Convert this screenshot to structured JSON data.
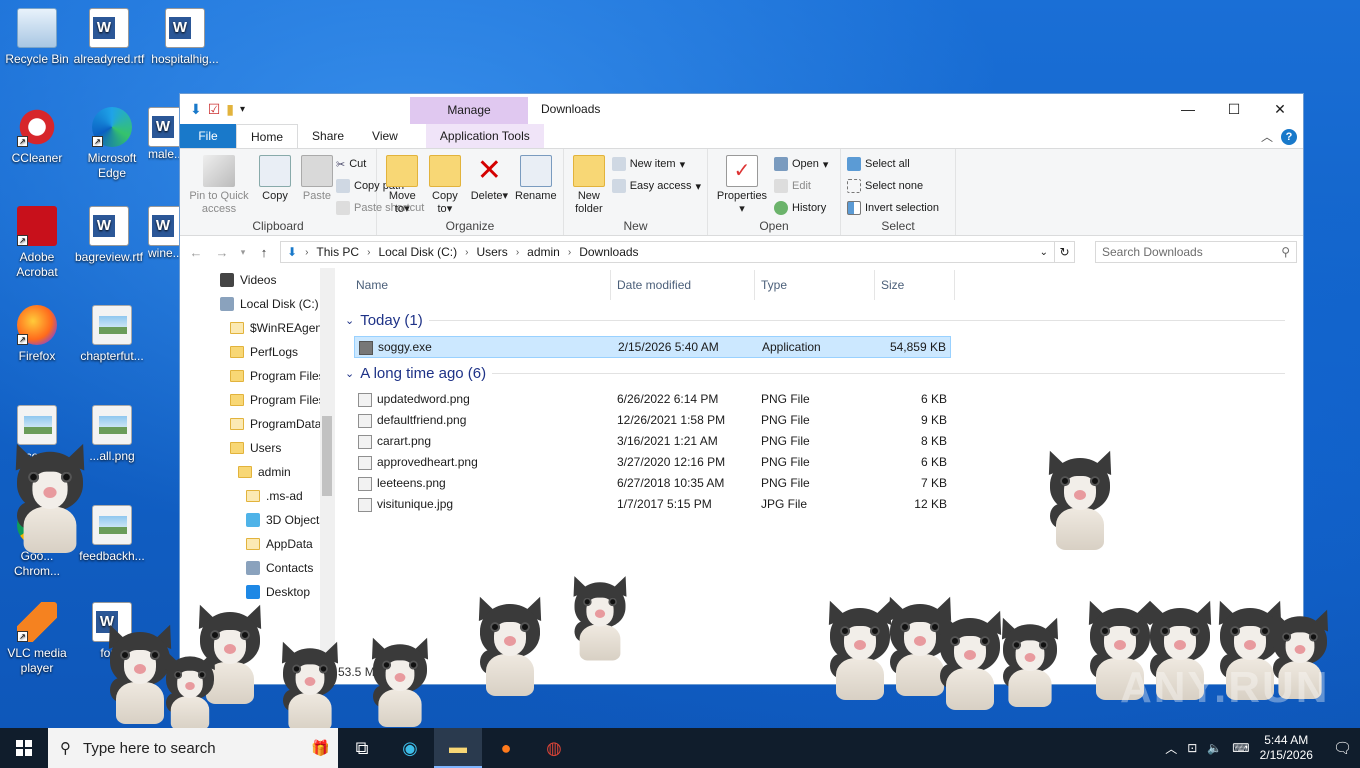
{
  "desktop": {
    "icons": [
      {
        "label": "Recycle Bin"
      },
      {
        "label": "alreadyred.rtf"
      },
      {
        "label": "hospitalhig..."
      },
      {
        "label": "CCleaner"
      },
      {
        "label": "Microsoft Edge"
      },
      {
        "label": "male..."
      },
      {
        "label": "Adobe Acrobat"
      },
      {
        "label": "bagreview.rtf"
      },
      {
        "label": "wine..."
      },
      {
        "label": "Firefox"
      },
      {
        "label": "chapterfut..."
      },
      {
        "label": "co..."
      },
      {
        "label": "...all.png"
      },
      {
        "label": "Goo... Chrom..."
      },
      {
        "label": "feedbackh..."
      },
      {
        "label": "VLC media player"
      },
      {
        "label": "for..."
      }
    ]
  },
  "window": {
    "title": "Downloads",
    "manage_label": "Manage",
    "tabs": [
      "File",
      "Home",
      "Share",
      "View",
      "Application Tools"
    ],
    "ribbon": {
      "clipboard": {
        "name": "Clipboard",
        "pin": "Pin to Quick access",
        "copy": "Copy",
        "paste": "Paste",
        "cut": "Cut",
        "copy_path": "Copy path",
        "paste_shortcut": "Paste shortcut"
      },
      "organize": {
        "name": "Organize",
        "move_to": "Move to",
        "copy_to": "Copy to",
        "delete": "Delete",
        "rename": "Rename"
      },
      "new": {
        "name": "New",
        "new_folder": "New folder",
        "new_item": "New item",
        "easy_access": "Easy access"
      },
      "open": {
        "name": "Open",
        "properties": "Properties",
        "open": "Open",
        "edit": "Edit",
        "history": "History"
      },
      "select": {
        "name": "Select",
        "select_all": "Select all",
        "select_none": "Select none",
        "invert": "Invert selection"
      }
    },
    "address": {
      "crumbs": [
        "This PC",
        "Local Disk (C:)",
        "Users",
        "admin",
        "Downloads"
      ],
      "search_placeholder": "Search Downloads"
    },
    "nav_items": [
      "Videos",
      "Local Disk (C:)",
      "$WinREAgent",
      "PerfLogs",
      "Program Files",
      "Program Files",
      "ProgramData",
      "Users",
      "admin",
      ".ms-ad",
      "3D Objects",
      "AppData",
      "Contacts",
      "Desktop"
    ],
    "columns": [
      "Name",
      "Date modified",
      "Type",
      "Size"
    ],
    "groups": {
      "today": "Today (1)",
      "long_ago": "A long time ago (6)"
    },
    "files_today": [
      {
        "name": "soggy.exe",
        "date": "2/15/2026 5:40 AM",
        "type": "Application",
        "size": "54,859 KB"
      }
    ],
    "files_old": [
      {
        "name": "updatedword.png",
        "date": "6/26/2022 6:14 PM",
        "type": "PNG File",
        "size": "6 KB"
      },
      {
        "name": "defaultfriend.png",
        "date": "12/26/2021 1:58 PM",
        "type": "PNG File",
        "size": "9 KB"
      },
      {
        "name": "carart.png",
        "date": "3/16/2021 1:21 AM",
        "type": "PNG File",
        "size": "8 KB"
      },
      {
        "name": "approvedheart.png",
        "date": "3/27/2020 12:16 PM",
        "type": "PNG File",
        "size": "6 KB"
      },
      {
        "name": "leeteens.png",
        "date": "6/27/2018 10:35 AM",
        "type": "PNG File",
        "size": "7 KB"
      },
      {
        "name": "visitunique.jpg",
        "date": "1/7/2017 5:15 PM",
        "type": "JPG File",
        "size": "12 KB"
      }
    ],
    "status_size": "53.5 M"
  },
  "taskbar": {
    "search_placeholder": "Type here to search",
    "time": "5:44 AM",
    "date": "2/15/2026"
  },
  "watermark": "ANY.RUN"
}
